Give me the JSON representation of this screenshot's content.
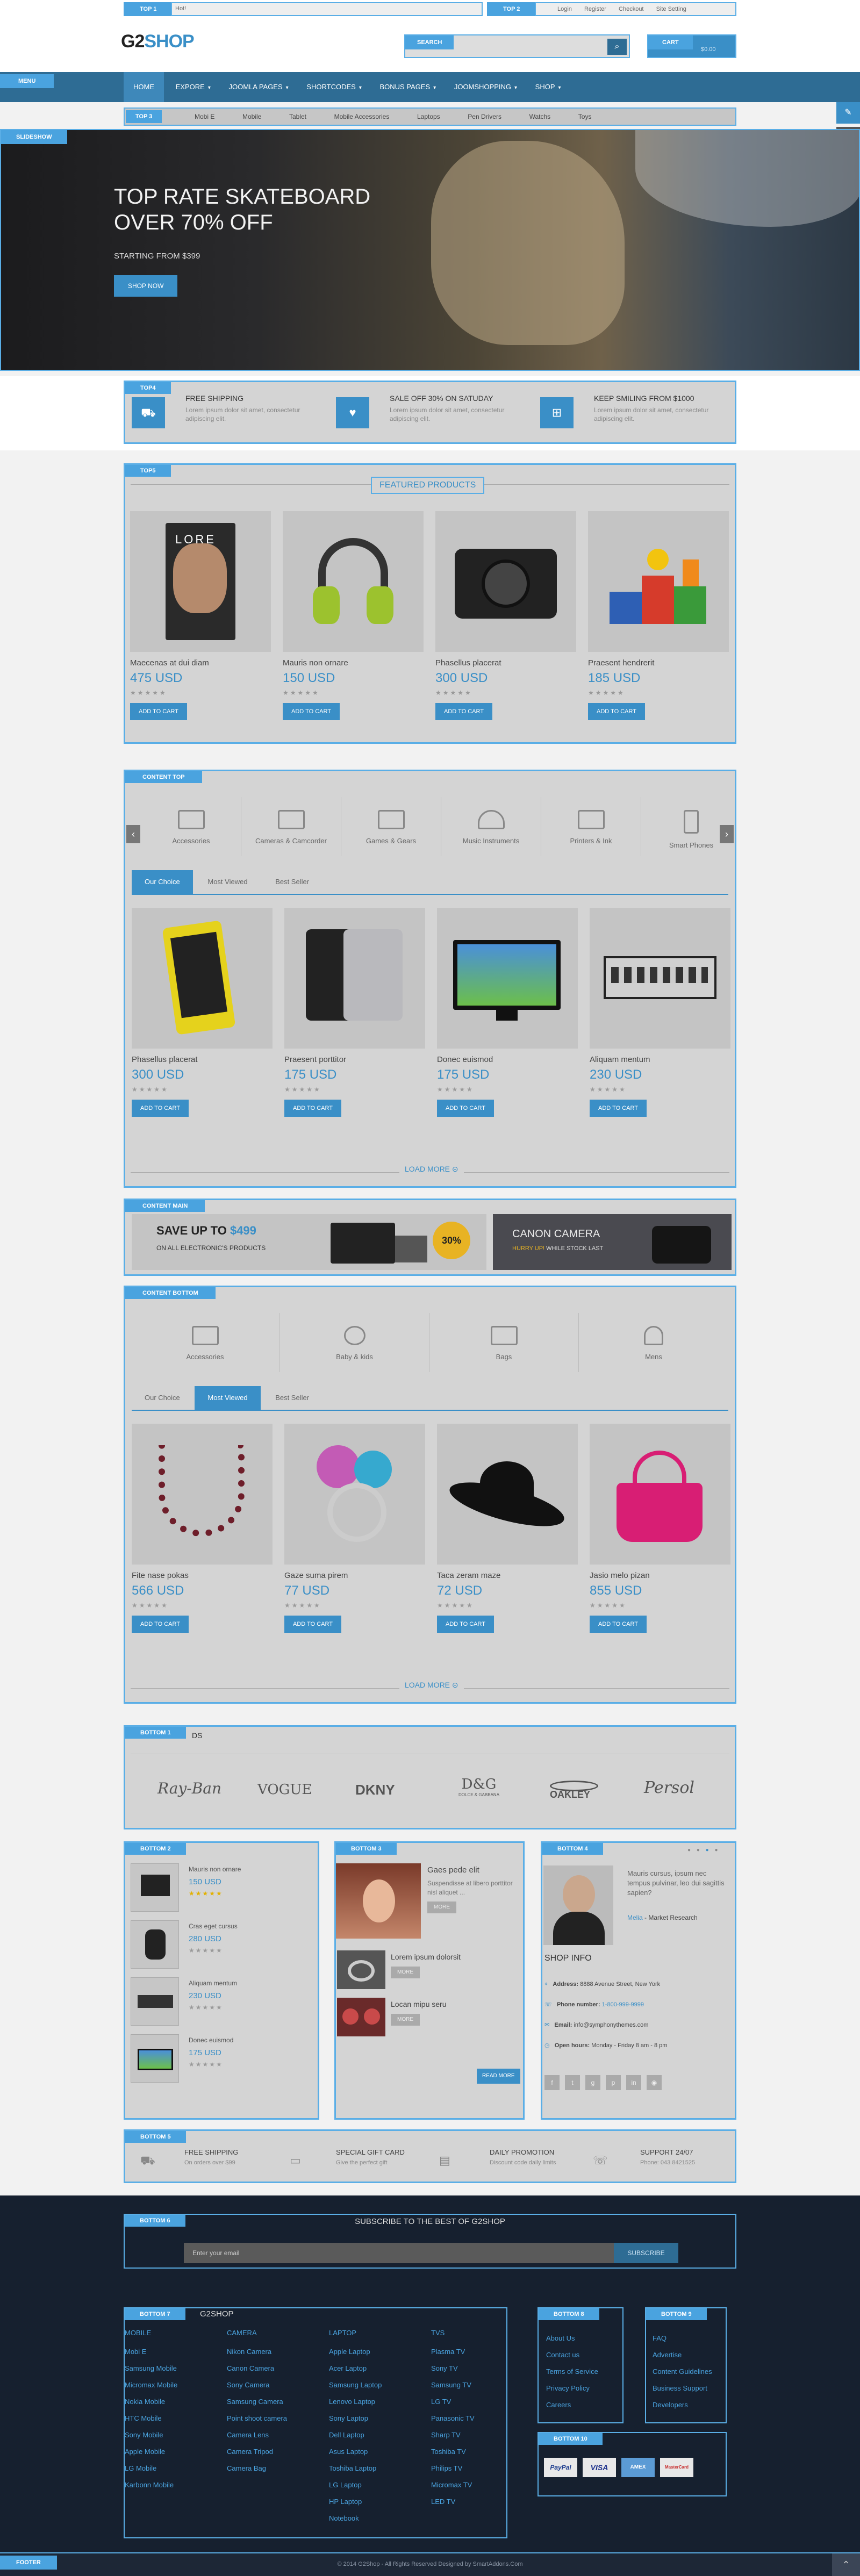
{
  "topbar": {
    "top1_tag": "TOP 1",
    "top1_text": "Hot!",
    "top2_tag": "TOP 2",
    "links": [
      "Login",
      "Register",
      "Checkout",
      "Site Setting"
    ]
  },
  "header": {
    "logo_g2": "G2",
    "logo_shop": "SHOP",
    "search_tag": "SEARCH",
    "cart_tag": "CART",
    "cart_total": "$0.00"
  },
  "nav": {
    "menu_tag": "MENU",
    "items": [
      "HOME",
      "EXPORE",
      "JOOMLA PAGES",
      "SHORTCODES",
      "BONUS PAGES",
      "JOOMSHOPPING",
      "SHOP"
    ]
  },
  "subnav": {
    "tag": "TOP 3",
    "items": [
      "Mobi E",
      "Mobile",
      "Tablet",
      "Mobile Accessories",
      "Laptops",
      "Pen Drivers",
      "Watchs",
      "Toys"
    ]
  },
  "slideshow": {
    "tag": "SLIDESHOW",
    "title_line1": "TOP RATE SKATEBOARD",
    "title_line2": "OVER 70% OFF",
    "subtitle": "STARTING FROM $399",
    "button": "SHOP NOW"
  },
  "top4": {
    "tag": "TOP4",
    "items": [
      {
        "title": "FREE SHIPPING",
        "text": "Lorem ipsum dolor sit amet, consectetur adipiscing elit.",
        "icon": "shipping-icon"
      },
      {
        "title": "SALE OFF 30% ON SATUDAY",
        "text": "Lorem ipsum dolor sit amet, consectetur adipiscing elit.",
        "icon": "heart-icon"
      },
      {
        "title": "KEEP SMILING FROM $1000",
        "text": "Lorem ipsum dolor sit amet, consectetur adipiscing elit.",
        "icon": "gift-icon"
      }
    ]
  },
  "top5": {
    "tag": "TOP5",
    "heading": "FEATURED PRODUCTS",
    "products": [
      {
        "name": "Maecenas at dui diam",
        "price": "475 USD",
        "stars": "★★★★★",
        "button": "ADD TO CART"
      },
      {
        "name": "Mauris non ornare",
        "price": "150 USD",
        "stars": "★★★★★",
        "button": "ADD TO CART"
      },
      {
        "name": "Phasellus placerat",
        "price": "300 USD",
        "stars": "★★★★★",
        "button": "ADD TO CART"
      },
      {
        "name": "Praesent hendrerit",
        "price": "185 USD",
        "stars": "★★★★★",
        "button": "ADD TO CART"
      }
    ]
  },
  "content_top": {
    "tag": "CONTENT TOP",
    "categories": [
      "Accessories",
      "Cameras & Camcorder",
      "Games & Gears",
      "Music Instruments",
      "Printers & Ink",
      "Smart Phones"
    ],
    "tabs": [
      "Our Choice",
      "Most Viewed",
      "Best Seller"
    ],
    "products": [
      {
        "name": "Phasellus placerat",
        "price": "300 USD",
        "stars": "★★★★★",
        "button": "ADD TO CART"
      },
      {
        "name": "Praesent porttitor",
        "price": "175 USD",
        "stars": "★★★★★",
        "button": "ADD TO CART"
      },
      {
        "name": "Donec euismod",
        "price": "175 USD",
        "stars": "★★★★★",
        "button": "ADD TO CART"
      },
      {
        "name": "Aliquam mentum",
        "price": "230 USD",
        "stars": "★★★★★",
        "button": "ADD TO CART"
      }
    ],
    "load_more": "LOAD MORE"
  },
  "content_main": {
    "tag": "CONTENT MAIN",
    "banner1_title": "SAVE UP TO",
    "banner1_price": "$499",
    "banner1_sub": "ON ALL ELECTRONIC'S PRODUCTS",
    "banner1_badge": "30%",
    "banner2_title": "CANON CAMERA",
    "banner2_sub1": "HURRY UP!",
    "banner2_sub2": "WHILE STOCK LAST"
  },
  "content_bottom": {
    "tag": "CONTENT BOTTOM",
    "categories": [
      "Accessories",
      "Baby & kids",
      "Bags",
      "Mens"
    ],
    "tabs": [
      "Our Choice",
      "Most Viewed",
      "Best Seller"
    ],
    "products": [
      {
        "name": "Fite nase pokas",
        "price": "566 USD",
        "stars": "★★★★★",
        "button": "ADD TO CART"
      },
      {
        "name": "Gaze suma pirem",
        "price": "77 USD",
        "stars": "★★★★★",
        "button": "ADD TO CART"
      },
      {
        "name": "Taca zeram maze",
        "price": "72 USD",
        "stars": "★★★★★",
        "button": "ADD TO CART"
      },
      {
        "name": "Jasio melo pizan",
        "price": "855 USD",
        "stars": "★★★★★",
        "button": "ADD TO CART"
      }
    ],
    "load_more": "LOAD MORE"
  },
  "bottom1": {
    "tag": "BOTTOM 1",
    "tag_suffix": "DS",
    "brands": [
      "Ray-Ban",
      "VOGUE",
      "DKNY",
      "D&G",
      "OAKLEY",
      "Persol"
    ],
    "dg_sub": "DOLCE & GABBANA"
  },
  "bottom2": {
    "tag": "BOTTOM 2",
    "items": [
      {
        "name": "Mauris non ornare",
        "price": "150 USD",
        "stars": "★★★★★"
      },
      {
        "name": "Cras eget cursus",
        "price": "280 USD",
        "stars": "★★★★★"
      },
      {
        "name": "Aliquam mentum",
        "price": "230 USD",
        "stars": "★★★★★"
      },
      {
        "name": "Donec euismod",
        "price": "175 USD",
        "stars": "★★★★★"
      }
    ]
  },
  "bottom3": {
    "tag": "BOTTOM 3",
    "feature_title": "Gaes pede elit",
    "feature_text": "Suspendisse at libero porttitor nisl aliquet ...",
    "feature_btn": "MORE",
    "posts": [
      {
        "title": "Lorem ipsum dolorsit",
        "btn": "MORE"
      },
      {
        "title": "Locan mipu seru",
        "btn": "MORE"
      }
    ],
    "read_more": "READ MORE"
  },
  "bottom4": {
    "tag": "BOTTOM 4",
    "quote": "Mauris cursus, ipsum nec tempus pulvinar, leo dui sagittis sapien?",
    "author": "Melia",
    "author_role": " - Market Research",
    "shop_info_title": "SHOP INFO",
    "address_label": "Address:",
    "address": "8888 Avenue Street, New York",
    "phone_label": "Phone number:",
    "phone": "1-800-999-9999",
    "email_label": "Email:",
    "email": "info@symphonythemes.com",
    "hours_label": "Open hours:",
    "hours": "Monday - Friday 8 am - 8 pm"
  },
  "bottom5": {
    "tag": "BOTTOM 5",
    "items": [
      {
        "title": "FREE SHIPPING",
        "text": "On orders over $99"
      },
      {
        "title": "SPECIAL GIFT CARD",
        "text": "Give the perfect gift"
      },
      {
        "title": "DAILY PROMOTION",
        "text": "Discount code daily limits"
      },
      {
        "title": "SUPPORT 24/07",
        "text": "Phone: 043 8421525"
      }
    ]
  },
  "bottom6": {
    "tag": "BOTTOM 6",
    "title": "SUBSCRIBE TO THE BEST OF G2SHOP",
    "placeholder": "Enter your email",
    "button": "SUBSCRIBE"
  },
  "bottom7": {
    "tag": "BOTTOM 7",
    "tag_suffix": "G2SHOP",
    "columns": [
      {
        "title": "MOBILE",
        "links": [
          "Mobi E",
          "Samsung Mobile",
          "Micromax Mobile",
          "Nokia Mobile",
          "HTC Mobile",
          "Sony Mobile",
          "Apple Mobile",
          "LG Mobile",
          "Karbonn Mobile"
        ]
      },
      {
        "title": "CAMERA",
        "links": [
          "Nikon Camera",
          "Canon Camera",
          "Sony Camera",
          "Samsung Camera",
          "Point shoot camera",
          "Camera Lens",
          "Camera Tripod",
          "Camera Bag"
        ]
      },
      {
        "title": "LAPTOP",
        "links": [
          "Apple Laptop",
          "Acer Laptop",
          "Samsung Laptop",
          "Lenovo Laptop",
          "Sony Laptop",
          "Dell Laptop",
          "Asus Laptop",
          "Toshiba Laptop",
          "LG Laptop",
          "HP Laptop",
          "Notebook"
        ]
      },
      {
        "title": "TVS",
        "links": [
          "Plasma TV",
          "Sony TV",
          "Samsung TV",
          "LG TV",
          "Panasonic TV",
          "Sharp TV",
          "Toshiba TV",
          "Philips TV",
          "Micromax TV",
          "LED TV"
        ]
      }
    ]
  },
  "bottom8": {
    "tag": "BOTTOM 8",
    "links": [
      "About Us",
      "Contact us",
      "Terms of Service",
      "Privacy Policy",
      "Careers"
    ]
  },
  "bottom9": {
    "tag": "BOTTOM 9",
    "links": [
      "FAQ",
      "Advertise",
      "Content Guidelines",
      "Business Support",
      "Developers"
    ]
  },
  "bottom10": {
    "tag": "BOTTOM 10",
    "cards": [
      "PayPal",
      "VISA",
      "AMEX",
      "MasterCard"
    ]
  },
  "footer": {
    "tag": "FOOTER",
    "copyright": "© 2014 G2Shop - All Rights Reserved Designed by SmartAddons.Com"
  },
  "colors": {
    "accent": "#4aa3df",
    "nav": "#2e6c94",
    "footer_bg": "#16202f"
  }
}
